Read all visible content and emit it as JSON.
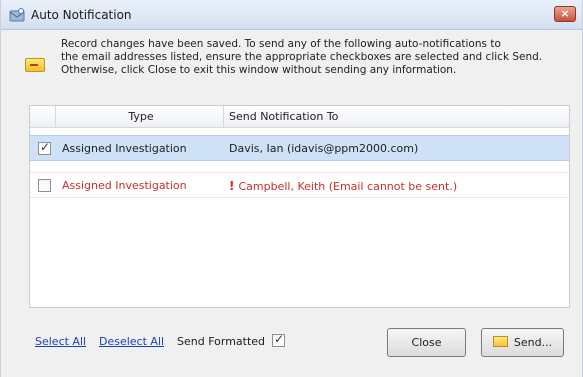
{
  "window": {
    "title": "Auto Notification",
    "close_glyph": "×",
    "accent_colors": {
      "error_text": "#c8302a",
      "link": "#1c3ebf",
      "selected_row": "#cfe1f7"
    }
  },
  "message": {
    "icon": "note-icon",
    "lines": [
      "Record changes have been saved. To send any of the following auto-notifications to",
      "the email addresses listed, ensure the appropriate checkboxes are selected and click Send.",
      "Otherwise, click Close to exit this window without sending any information."
    ]
  },
  "grid": {
    "columns": [
      "Type",
      "Send Notification To"
    ],
    "rows": [
      {
        "checked": true,
        "type": "Assigned Investigation",
        "send_to": "Davis,  Ian (idavis@ppm2000.com)",
        "error": false
      },
      {
        "checked": false,
        "type": "Assigned Investigation",
        "send_to": "Campbell, Keith (Email cannot be sent.)",
        "error": true,
        "icon": "exclamation-icon"
      }
    ]
  },
  "footer": {
    "select_all": "Select All",
    "deselect_all": "Deselect All",
    "send_formatted_label": "Send Formatted",
    "send_formatted_checked": true,
    "close_label": "Close",
    "send_label": "Send..."
  }
}
